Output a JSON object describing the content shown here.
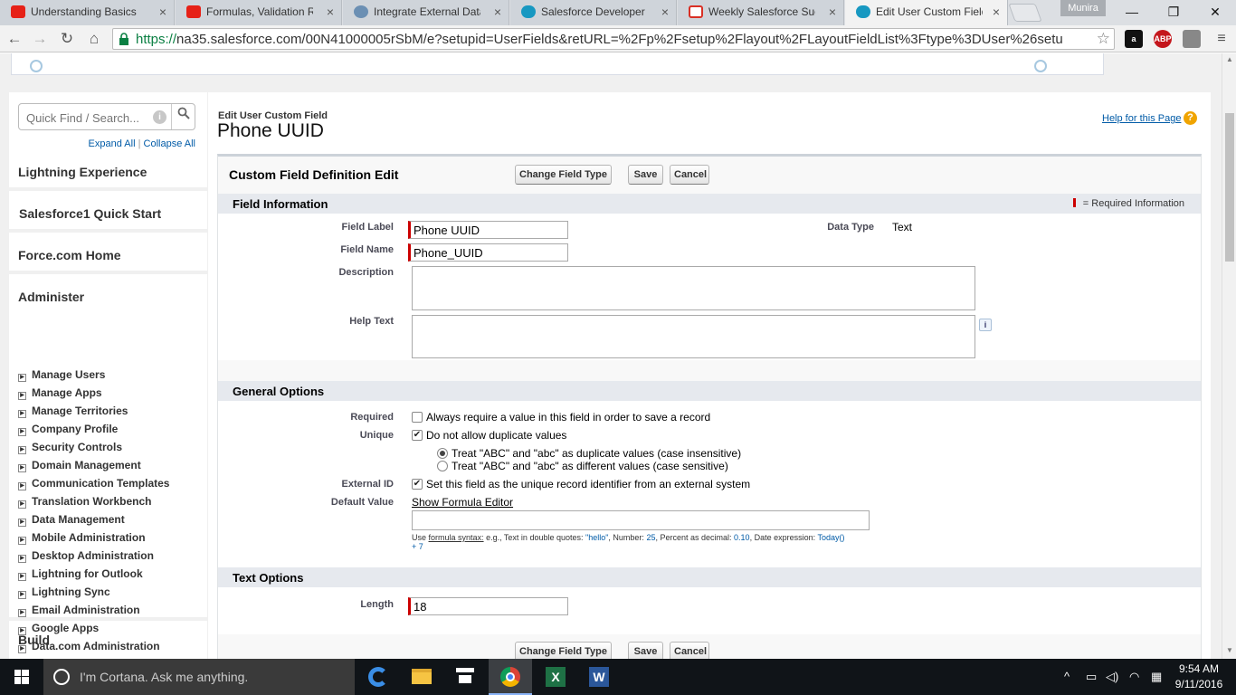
{
  "browser": {
    "tabs": [
      {
        "label": "Understanding Basics of",
        "icon": "youtube-icon",
        "color": "#e62117"
      },
      {
        "label": "Formulas, Validation Rul",
        "icon": "youtube-icon",
        "color": "#e62117"
      },
      {
        "label": "Integrate External Data",
        "icon": "globe-icon",
        "color": "#6b8fb3"
      },
      {
        "label": "Salesforce Developer Co",
        "icon": "salesforce-cloud-icon",
        "color": "#1798c1"
      },
      {
        "label": "Weekly Salesforce Succe",
        "icon": "gmail-icon",
        "color": "#d93025"
      },
      {
        "label": "Edit User Custom Field:",
        "icon": "salesforce-cloud-icon",
        "color": "#1798c1"
      }
    ],
    "profile_name": "Munira",
    "url_scheme": "https://",
    "url_rest": "na35.salesforce.com/00N41000005rSbM/e?setupid=UserFields&retURL=%2Fp%2Fsetup%2Flayout%2FLayoutFieldList%3Ftype%3DUser%26setu",
    "ext_abp": "ABP"
  },
  "sidebar": {
    "search_placeholder": "Quick Find / Search...",
    "expand_all": "Expand All",
    "separator": "|",
    "collapse_all": "Collapse All",
    "sections": [
      "Lightning Experience",
      "Salesforce1 Quick Start",
      "Force.com Home"
    ],
    "administer_title": "Administer",
    "administer_items": [
      "Manage Users",
      "Manage Apps",
      "Manage Territories",
      "Company Profile",
      "Security Controls",
      "Domain Management",
      "Communication Templates",
      "Translation Workbench",
      "Data Management",
      "Mobile Administration",
      "Desktop Administration",
      "Lightning for Outlook",
      "Lightning Sync",
      "Email Administration",
      "Google Apps",
      "Data.com Administration"
    ],
    "build_title": "Build"
  },
  "page": {
    "breadcrumb": "Edit User Custom Field",
    "title": "Phone UUID",
    "help_link": "Help for this Page",
    "block_title": "Custom Field Definition Edit",
    "btn_change_type": "Change Field Type",
    "btn_save": "Save",
    "btn_cancel": "Cancel"
  },
  "field_info": {
    "heading": "Field Information",
    "required_legend": "= Required Information",
    "field_label_label": "Field Label",
    "field_label_value": "Phone UUID",
    "field_name_label": "Field Name",
    "field_name_value": "Phone_UUID",
    "description_label": "Description",
    "help_text_label": "Help Text",
    "data_type_label": "Data Type",
    "data_type_value": "Text"
  },
  "general_options": {
    "heading": "General Options",
    "required_label": "Required",
    "required_text": "Always require a value in this field in order to save a record",
    "required_checked": false,
    "unique_label": "Unique",
    "unique_text": "Do not allow duplicate values",
    "unique_checked": true,
    "case_insensitive": "Treat \"ABC\" and \"abc\" as duplicate values (case insensitive)",
    "case_sensitive": "Treat \"ABC\" and \"abc\" as different values (case sensitive)",
    "external_id_label": "External ID",
    "external_id_text": "Set this field as the unique record identifier from an external system",
    "external_id_checked": true,
    "default_value_label": "Default Value",
    "show_formula_editor": "Show Formula Editor",
    "hint_prefix": "Use",
    "hint_syntax": "formula syntax:",
    "hint_text1": "e.g., Text in double quotes:",
    "hint_hello": "\"hello\"",
    "hint_text2": ", Number:",
    "hint_25": "25",
    "hint_text3": ", Percent as decimal:",
    "hint_010": "0.10",
    "hint_text4": ", Date expression:",
    "hint_today": "Today()",
    "hint_plus7": "+ 7"
  },
  "text_options": {
    "heading": "Text Options",
    "length_label": "Length",
    "length_value": "18"
  },
  "taskbar": {
    "cortana_placeholder": "I'm Cortana. Ask me anything.",
    "time": "9:54 AM",
    "date": "9/11/2016"
  }
}
